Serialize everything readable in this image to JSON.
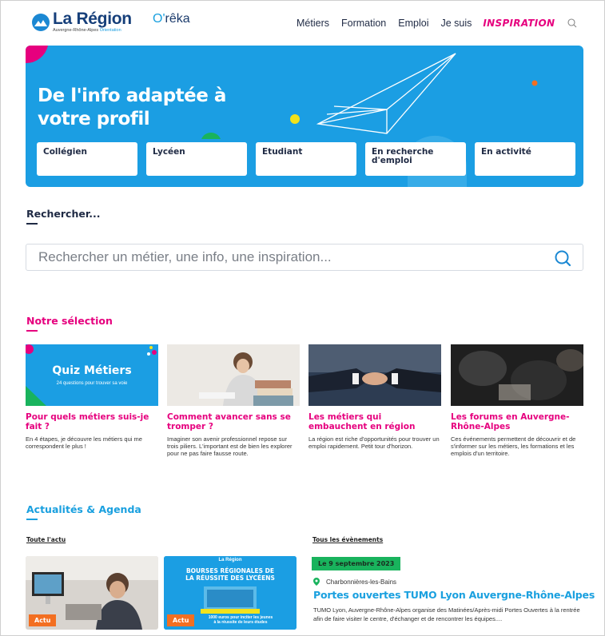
{
  "header": {
    "logo_title": "La Région",
    "logo_sub": "Auvergne-Rhône-Alpes",
    "logo_sub_accent": "Orientation",
    "oreka_prefix": "O'",
    "oreka_suffix": "rêka",
    "nav": [
      "Métiers",
      "Formation",
      "Emploi",
      "Je suis"
    ],
    "inspiration": "INSPIRATION"
  },
  "hero": {
    "title": "De l'info adaptée à\nvotre profil",
    "profiles": [
      "Collégien",
      "Lycéen",
      "Etudiant",
      "En recherche d'emploi",
      "En activité"
    ],
    "colors": {
      "background": "#1b9ee3"
    }
  },
  "search": {
    "title": "Rechercher...",
    "placeholder": "Rechercher un métier, une info, une inspiration..."
  },
  "selection": {
    "title": "Notre sélection",
    "quiz_title": "Quiz Métiers",
    "quiz_sub": "24 questions pour trouver sa voie",
    "cards": [
      {
        "title": "Pour quels métiers suis-je fait ?",
        "desc": "En 4 étapes, je découvre les métiers qui me correspondent le plus !"
      },
      {
        "title": "Comment avancer sans se tromper ?",
        "desc": "Imaginer son avenir professionnel repose sur trois piliers. L'important est de bien les explorer pour ne pas faire fausse route."
      },
      {
        "title": "Les métiers qui embauchent en région",
        "desc": "La région est riche d'opportunités pour trouver un emploi rapidement. Petit tour d'horizon."
      },
      {
        "title": "Les forums en Auvergne-Rhône-Alpes",
        "desc": "Ces événements permettent de découvrir et de s'informer sur les métiers, les formations et les emplois d'un territoire."
      }
    ]
  },
  "news": {
    "title": "Actualités & Agenda",
    "all_news": "Toute l'actu",
    "all_events": "Tous les évènements",
    "badge": "Actu",
    "poster_logo": "La Région",
    "poster_title": "BOURSES RÉGIONALES DE\nLA RÉUSSITE DES LYCÉENS",
    "poster_sub": "1000 euros pour inciter les jeunes\nà la réussite de leurs études",
    "event": {
      "date": "Le 9 septembre 2023",
      "location": "Charbonnières-les-Bains",
      "title": "Portes ouvertes TUMO Lyon Auvergne-Rhône-Alpes",
      "desc": "TUMO Lyon, Auvergne-Rhône-Alpes organise des Matinées/Après-midi Portes Ouvertes à la rentrée afin de faire visiter le centre, d'échanger et de rencontrer les équipes...."
    }
  },
  "colors": {
    "magenta": "#e6007e",
    "blue": "#1aa0df",
    "navy": "#163f7a",
    "green": "#19b35d",
    "orange": "#f36f21"
  }
}
